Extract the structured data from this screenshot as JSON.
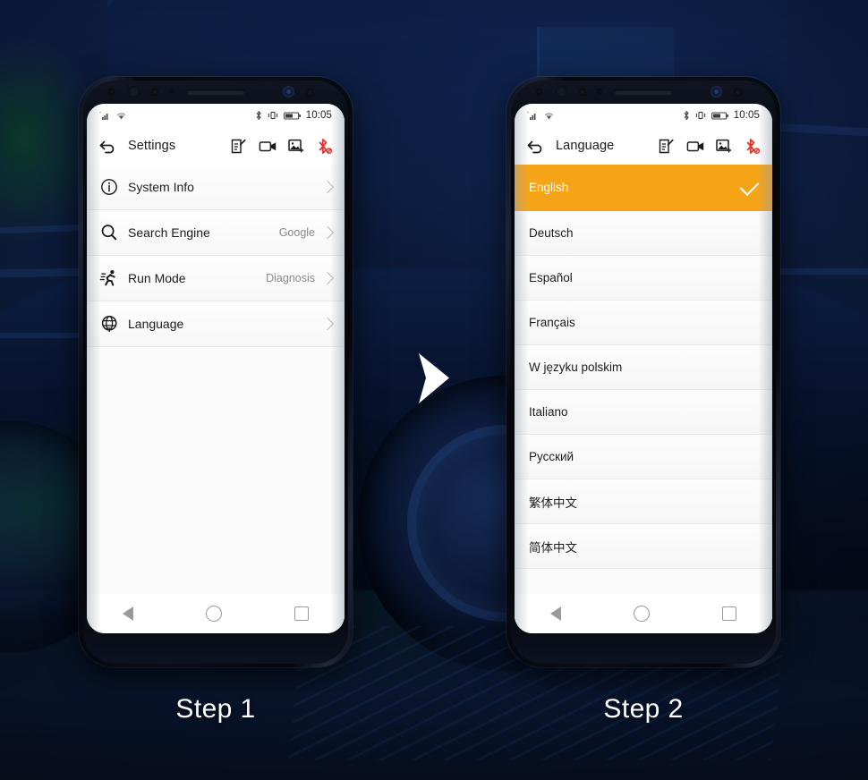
{
  "background": {
    "base_color": "#0c1c40",
    "description": "dark navy automotive photo backdrop"
  },
  "arrow": {
    "name": "right-chevron",
    "color": "#ffffff"
  },
  "steps": [
    {
      "label": "Step 1"
    },
    {
      "label": "Step 2"
    }
  ],
  "phone1": {
    "status_bar": {
      "signal_icon": "signal-bars-icon",
      "wifi_icon": "wifi-icon",
      "bluetooth_icon": "bluetooth-icon",
      "vibrate_icon": "vibrate-icon",
      "battery_icon": "battery-icon",
      "time": "10:05"
    },
    "toolbar": {
      "back_icon": "back-arrow-icon",
      "title": "Settings",
      "actions": [
        {
          "name": "note-icon"
        },
        {
          "name": "video-record-icon"
        },
        {
          "name": "screenshot-icon"
        },
        {
          "name": "bluetooth-disconnected-icon",
          "color": "#e8322a"
        }
      ]
    },
    "rows": [
      {
        "icon": "info-circle-icon",
        "label": "System Info",
        "value": ""
      },
      {
        "icon": "search-icon",
        "label": "Search Engine",
        "value": "Google"
      },
      {
        "icon": "runner-icon",
        "label": "Run Mode",
        "value": "Diagnosis"
      },
      {
        "icon": "globe-icon",
        "label": "Language",
        "value": ""
      }
    ],
    "nav": {
      "back": "nav-back-icon",
      "home": "nav-home-icon",
      "recents": "nav-recents-icon"
    }
  },
  "phone2": {
    "status_bar": {
      "signal_icon": "signal-bars-icon",
      "wifi_icon": "wifi-icon",
      "bluetooth_icon": "bluetooth-icon",
      "vibrate_icon": "vibrate-icon",
      "battery_icon": "battery-icon",
      "time": "10:05"
    },
    "toolbar": {
      "back_icon": "back-arrow-icon",
      "title": "Language",
      "actions": [
        {
          "name": "note-icon"
        },
        {
          "name": "video-record-icon"
        },
        {
          "name": "screenshot-icon"
        },
        {
          "name": "bluetooth-disconnected-icon",
          "color": "#e8322a"
        }
      ]
    },
    "selected_highlight_color": "#f5a317",
    "languages": [
      {
        "label": "English",
        "selected": true
      },
      {
        "label": "Deutsch",
        "selected": false
      },
      {
        "label": "Español",
        "selected": false
      },
      {
        "label": "Français",
        "selected": false
      },
      {
        "label": "W języku polskim",
        "selected": false
      },
      {
        "label": "Italiano",
        "selected": false
      },
      {
        "label": "Русский",
        "selected": false
      },
      {
        "label": "繁体中文",
        "selected": false
      },
      {
        "label": "简体中文",
        "selected": false
      }
    ],
    "nav": {
      "back": "nav-back-icon",
      "home": "nav-home-icon",
      "recents": "nav-recents-icon"
    }
  }
}
